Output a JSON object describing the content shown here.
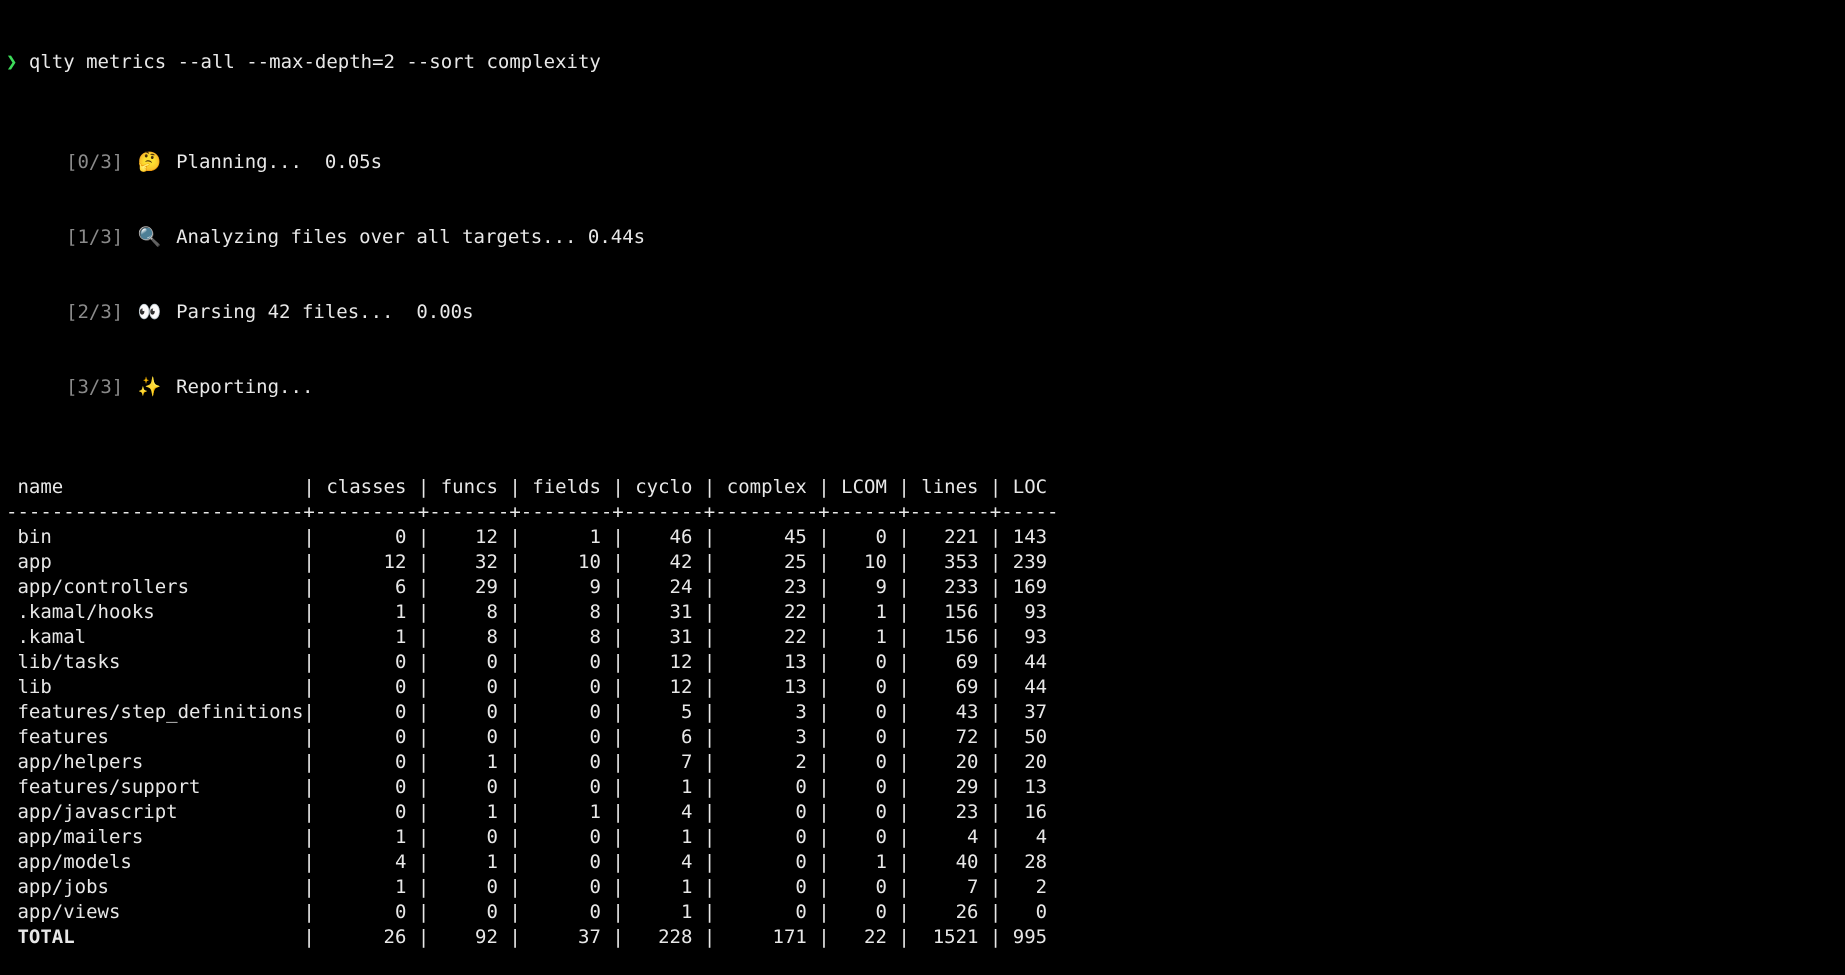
{
  "command": {
    "prompt_symbol": "❯",
    "text": "qlty metrics --all --max-depth=2 --sort complexity"
  },
  "progress": [
    {
      "step": "[0/3]",
      "icon": "🤔",
      "message": "Planning...  0.05s"
    },
    {
      "step": "[1/3]",
      "icon": "🔍",
      "message": "Analyzing files over all targets... 0.44s"
    },
    {
      "step": "[2/3]",
      "icon": "👀",
      "message": "Parsing 42 files...  0.00s"
    },
    {
      "step": "[3/3]",
      "icon": "✨",
      "message": "Reporting..."
    }
  ],
  "table": {
    "columns": [
      "name",
      "classes",
      "funcs",
      "fields",
      "cyclo",
      "complex",
      "LCOM",
      "lines",
      "LOC"
    ],
    "rows": [
      [
        "bin",
        "0",
        "12",
        "1",
        "46",
        "45",
        "0",
        "221",
        "143"
      ],
      [
        "app",
        "12",
        "32",
        "10",
        "42",
        "25",
        "10",
        "353",
        "239"
      ],
      [
        "app/controllers",
        "6",
        "29",
        "9",
        "24",
        "23",
        "9",
        "233",
        "169"
      ],
      [
        ".kamal/hooks",
        "1",
        "8",
        "8",
        "31",
        "22",
        "1",
        "156",
        "93"
      ],
      [
        ".kamal",
        "1",
        "8",
        "8",
        "31",
        "22",
        "1",
        "156",
        "93"
      ],
      [
        "lib/tasks",
        "0",
        "0",
        "0",
        "12",
        "13",
        "0",
        "69",
        "44"
      ],
      [
        "lib",
        "0",
        "0",
        "0",
        "12",
        "13",
        "0",
        "69",
        "44"
      ],
      [
        "features/step_definitions",
        "0",
        "0",
        "0",
        "5",
        "3",
        "0",
        "43",
        "37"
      ],
      [
        "features",
        "0",
        "0",
        "0",
        "6",
        "3",
        "0",
        "72",
        "50"
      ],
      [
        "app/helpers",
        "0",
        "1",
        "0",
        "7",
        "2",
        "0",
        "20",
        "20"
      ],
      [
        "features/support",
        "0",
        "0",
        "0",
        "1",
        "0",
        "0",
        "29",
        "13"
      ],
      [
        "app/javascript",
        "0",
        "1",
        "1",
        "4",
        "0",
        "0",
        "23",
        "16"
      ],
      [
        "app/mailers",
        "1",
        "0",
        "0",
        "1",
        "0",
        "0",
        "4",
        "4"
      ],
      [
        "app/models",
        "4",
        "1",
        "0",
        "4",
        "0",
        "1",
        "40",
        "28"
      ],
      [
        "app/jobs",
        "1",
        "0",
        "0",
        "1",
        "0",
        "0",
        "7",
        "2"
      ],
      [
        "app/views",
        "0",
        "0",
        "0",
        "1",
        "0",
        "0",
        "26",
        "0"
      ]
    ],
    "total": [
      "TOTAL",
      "26",
      "92",
      "37",
      "228",
      "171",
      "22",
      "1521",
      "995"
    ]
  },
  "colors": {
    "background": "#000000",
    "foreground": "#e8e8e8",
    "prompt": "#3ddc5a",
    "dim": "#8a8a8a"
  },
  "icons": {
    "prompt": "chevron-right-icon",
    "planning": "thinking-face-icon",
    "analyzing": "magnifier-icon",
    "parsing": "eyes-icon",
    "reporting": "sparkles-icon"
  }
}
